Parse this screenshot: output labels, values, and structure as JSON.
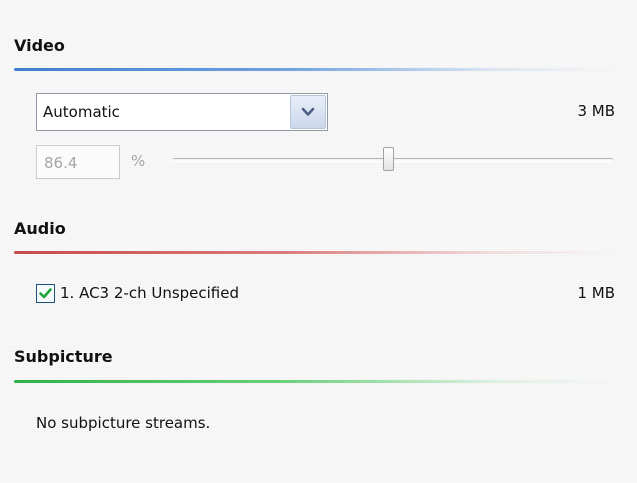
{
  "video": {
    "title": "Video",
    "mode_selected": "Automatic",
    "size": "3 MB",
    "quality_value": "86.4",
    "quality_unit": "%",
    "quality_slider_fraction": 0.49
  },
  "audio": {
    "title": "Audio",
    "tracks": [
      {
        "label": "1. AC3 2-ch Unspecified",
        "checked": true,
        "size": "1 MB"
      }
    ]
  },
  "subpicture": {
    "title": "Subpicture",
    "message": "No subpicture streams."
  },
  "colors": {
    "video_accent": "#3f7fd0",
    "audio_accent": "#c84a4a",
    "subpicture_accent": "#2fb24a",
    "checkmark": "#1ea63b"
  },
  "icons": {
    "dropdown": "chevron-down-icon",
    "checkbox": "check-icon"
  }
}
